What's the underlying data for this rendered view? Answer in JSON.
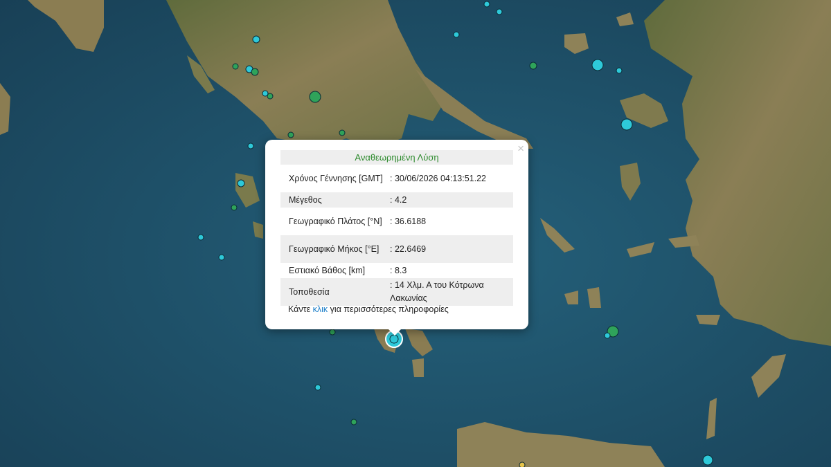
{
  "popup": {
    "title": "Αναθεωρημένη Λύση",
    "close_symbol": "×",
    "rows": [
      {
        "label": "Χρόνος Γέννησης [GMT]",
        "value": ": 30/06/2026 04:13:51.22"
      },
      {
        "label": "Μέγεθος",
        "value": ": 4.2"
      },
      {
        "label": "Γεωγραφικό Πλάτος [°N]",
        "value": ": 36.6188"
      },
      {
        "label": "Γεωγραφικό Μήκος [°E]",
        "value": ": 22.6469"
      },
      {
        "label": "Εστιακό Βάθος [km]",
        "value": ": 8.3"
      },
      {
        "label": "Τοποθεσία",
        "value": ": 14 Χλμ. Α του Κότρωνα Λακωνίας"
      }
    ],
    "more_prefix": "Κάντε ",
    "more_link": "κλικ",
    "more_suffix": " για περισσότερες πληροφορίες"
  },
  "colors": {
    "sea": "#1f4f66",
    "land": "#7d7a52",
    "title_green": "#2e8b2e",
    "link_blue": "#1a7dc8",
    "marker_cyan": "#2ec9d9",
    "marker_green": "#2fa35a"
  }
}
